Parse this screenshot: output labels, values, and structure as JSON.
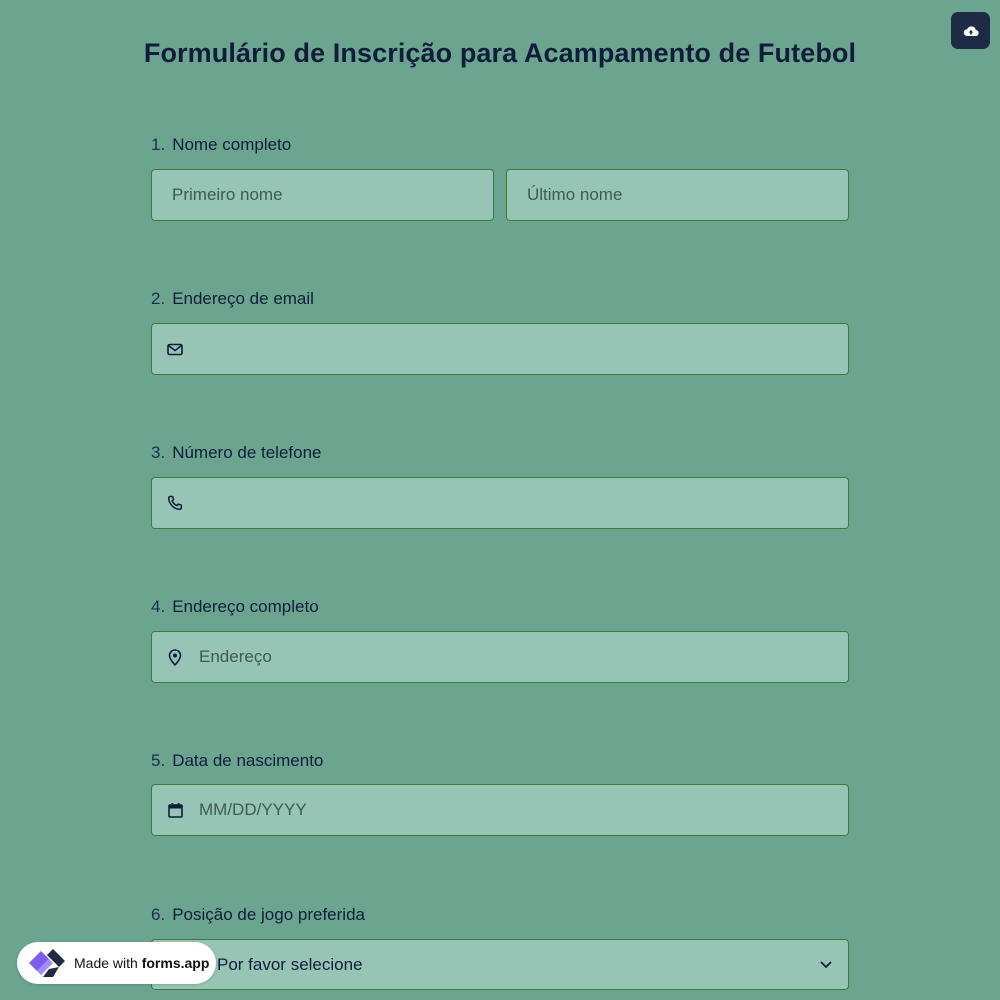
{
  "header": {
    "title": "Formulário de Inscrição para Acampamento de Futebol",
    "upload_icon": "cloud-upload-icon"
  },
  "questions": [
    {
      "number": "1.",
      "label": "Nome completo",
      "first_placeholder": "Primeiro nome",
      "last_placeholder": "Último nome"
    },
    {
      "number": "2.",
      "label": "Endereço de email",
      "placeholder": "",
      "icon": "envelope-icon"
    },
    {
      "number": "3.",
      "label": "Número de telefone",
      "placeholder": "",
      "icon": "phone-icon"
    },
    {
      "number": "4.",
      "label": "Endereço completo",
      "placeholder": "Endereço",
      "icon": "map-pin-icon"
    },
    {
      "number": "5.",
      "label": "Data de nascimento",
      "placeholder": "MM/DD/YYYY",
      "icon": "calendar-icon"
    },
    {
      "number": "6.",
      "label": "Posição de jogo preferida",
      "selected": "Por favor selecione",
      "icon": "chevron-down-icon"
    }
  ],
  "badge": {
    "prefix": "Made with",
    "brand": "forms.app",
    "logo_colors": [
      "#7b5cf5",
      "#1f2a44"
    ]
  },
  "colors": {
    "background": "#6ba590",
    "field_bg": "#97c5b5",
    "field_border": "#3e7a3e",
    "title": "#0f1d3a"
  }
}
